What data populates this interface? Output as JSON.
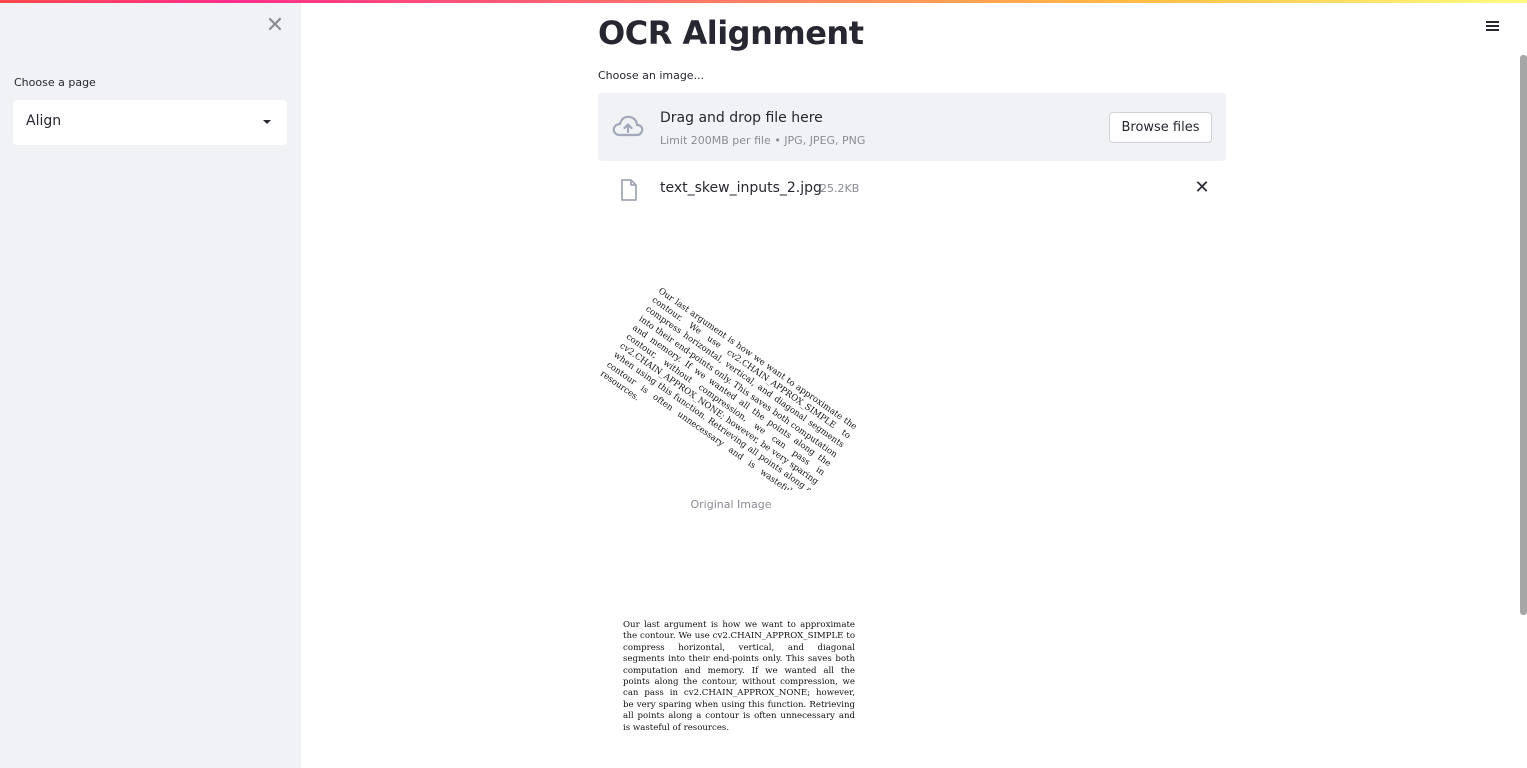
{
  "sidebar": {
    "close_glyph": "✕",
    "page_select_label": "Choose a page",
    "page_select_value": "Align"
  },
  "main": {
    "title": "OCR Alignment",
    "uploader": {
      "label": "Choose an image...",
      "drop_title": "Drag and drop file here",
      "limit_text": "Limit 200MB per file • JPG, JPEG, PNG",
      "browse_label": "Browse files"
    },
    "uploaded_file": {
      "name": "text_skew_inputs_2.jpg",
      "size": "25.2KB",
      "delete_glyph": "✕"
    },
    "original_image": {
      "caption": "Original Image",
      "text": "Our last argument is how we want to approximate the contour. We use cv2.CHAIN_APPROX_SIMPLE to compress horizontal, vertical, and diagonal segments into their end-points only. This saves both computation and memory. If we wanted all the points along the contour, without compression, we can pass in cv2.CHAIN_APPROX_NONE; however, be very sparing when using this function. Retrieving all points along a contour is often unnecessary and is wasteful of resources."
    },
    "aligned_image": {
      "text": "Our last argument is how we want to approximate the contour. We use cv2.CHAIN_APPROX_SIMPLE to compress horizontal, vertical, and diagonal segments into their end-points only. This saves both computation and memory. If we wanted all the points along the contour, without compression, we can pass in cv2.CHAIN_APPROX_NONE; however, be very sparing when using this function. Retrieving all points along a contour is often unnecessary and is wasteful of resources."
    }
  },
  "icons": {
    "close": "close-icon",
    "dropdown": "caret-down-icon",
    "menu": "hamburger-menu-icon",
    "upload": "cloud-upload-icon",
    "file": "file-icon",
    "delete": "close-icon"
  },
  "colors": {
    "sidebar_bg": "#f0f2f6",
    "text": "#262730",
    "muted_text": "#8a8c94",
    "dropzone_bg": "#f0f2f6",
    "icon_gray": "#a3a8b8"
  }
}
